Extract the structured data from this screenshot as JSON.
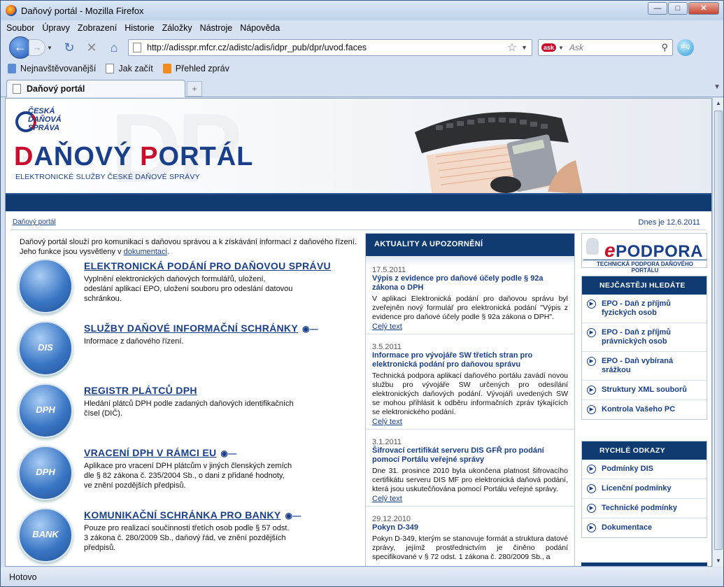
{
  "window": {
    "title": "Daňový portál - Mozilla Firefox"
  },
  "menu": [
    "Soubor",
    "Úpravy",
    "Zobrazení",
    "Historie",
    "Záložky",
    "Nástroje",
    "Nápověda"
  ],
  "nav": {
    "url": "http://adisspr.mfcr.cz/adistc/adis/idpr_pub/dpr/uvod.faces",
    "search_engine": "Ask",
    "search_placeholder": "Ask",
    "icons": {
      "back": "back-arrow-icon",
      "forward": "forward-arrow-icon",
      "reload": "reload-icon",
      "stop": "stop-icon",
      "home": "home-icon",
      "bookmark_star": "star-icon",
      "search": "magnifier-icon"
    }
  },
  "bookmarks": [
    "Nejnavštěvovanější",
    "Jak začít",
    "Přehled zpráv"
  ],
  "tab": {
    "title": "Daňový portál",
    "new_tab": "+"
  },
  "status": "Hotovo",
  "site": {
    "logo_lines": [
      "ČESKÁ",
      "DAŇOVÁ",
      "SPRÁVA"
    ],
    "brand_d": "D",
    "brand_rest1": "AŇOVÝ ",
    "brand_p": "P",
    "brand_rest2": "ORTÁL",
    "brand_sub": "ELEKTRONICKÉ SLUŽBY ČESKÉ DAŇOVÉ SPRÁVY",
    "bg_text": "DP",
    "breadcrumb": "Daňový portál",
    "today": "Dnes je 12.6.2011",
    "intro_1": "Daňový portál slouží pro komunikaci s daňovou správou a k získávání informací z daňového řízení. Jeho funkce jsou vysvětleny v",
    "intro_link": "dokumentaci",
    "intro_end": "."
  },
  "services": [
    {
      "icon": "",
      "title": "ELEKTRONICKÁ PODÁNÍ PRO DAŇOVOU SPRÁVU",
      "key": false,
      "desc": "Vyplnění elektronických daňových formulářů, uložení, odeslání aplikací EPO, uložení souboru pro odeslání datovou schránkou."
    },
    {
      "icon": "DIS",
      "title": "SLUŽBY DAŇOVÉ INFORMAČNÍ SCHRÁNKY",
      "key": true,
      "desc": "Informace z daňového řízení."
    },
    {
      "icon": "DPH",
      "title": "REGISTR PLÁTCŮ DPH",
      "key": false,
      "desc": "Hledání plátců DPH podle zadaných daňových identifikačních čísel (DIČ)."
    },
    {
      "icon": "DPH",
      "title": "VRACENÍ DPH V RÁMCI EU",
      "key": true,
      "desc": "Aplikace pro vracení DPH plátcům v jiných členských zemích dle § 82 zákona č. 235/2004 Sb., o dani z přidané hodnoty, ve znění pozdějších předpisů."
    },
    {
      "icon": "BANK",
      "title": "KOMUNIKAČNÍ SCHRÁNKA PRO BANKY",
      "key": true,
      "desc": "Pouze pro realizaci součinnosti třetích osob podle § 57 odst. 3 zákona č. 280/2009 Sb., daňový řád, ve znění pozdějších předpisů."
    }
  ],
  "news": {
    "header": "AKTUALITY A UPOZORNĚNÍ",
    "items": [
      {
        "date": "17.5.2011",
        "title": "Výpis z evidence pro daňové účely podle § 92a zákona o DPH",
        "body": "V aplikaci Elektronická podání pro daňovou správu byl zveřejněn nový formulář pro elektronická podání \"Výpis z evidence pro daňové účely podle § 92a zákona o DPH\".",
        "more": "Celý text"
      },
      {
        "date": "3.5.2011",
        "title": "Informace pro vývojáře SW třetích stran pro elektronická podání pro daňovou správu",
        "body": "Technická podpora aplikací daňového portálu zavádí novou službu pro vývojáře SW určených pro odesílání elektronických daňových podání. Vývojáři uvedených SW se mohou přihlásit k odběru informačních zpráv týkajících se elektronického podání.",
        "more": "Celý text"
      },
      {
        "date": "3.1.2011",
        "title": "Šifrovací certifikát serveru DIS GFŘ pro podání pomocí Portálu veřejné správy",
        "body": "Dne 31. prosince 2010 byla ukončena platnost šifrovacího certifikátu serveru DIS MF pro elektronická daňová podání, která jsou uskutečňována pomocí Portálu veřejné správy.",
        "more": "Celý text"
      },
      {
        "date": "29.12.2010",
        "title": "Pokyn D-349",
        "body": "Pokyn D-349, kterým se stanovuje formát a struktura datové zprávy, jejímž prostřednictvím je činěno podání specifikované v § 72 odst. 1 zákona č. 280/2009 Sb., a",
        "more": ""
      }
    ]
  },
  "epodpora": {
    "e": "e",
    "main": "PODPORA",
    "sub": "TECHNICKÁ PODPORA DAŇOVÉHO PORTÁLU"
  },
  "faq": {
    "header": "NEJČASTĚJI HLEDÁTE",
    "links": [
      "EPO - Daň z příjmů fyzických osob",
      "EPO - Daň z příjmů právnických osob",
      "EPO - Daň vybíraná srážkou",
      "Struktury XML souborů",
      "Kontrola Vašeho PC"
    ]
  },
  "quick": {
    "header": "RYCHLÉ ODKAZY",
    "links": [
      "Podmínky DIS",
      "Licenční podmínky",
      "Technické podmínky",
      "Dokumentace"
    ]
  },
  "colors": {
    "brand_blue": "#1a3f8a",
    "brand_red": "#c8102e",
    "nav_dark": "#0f3a72"
  }
}
